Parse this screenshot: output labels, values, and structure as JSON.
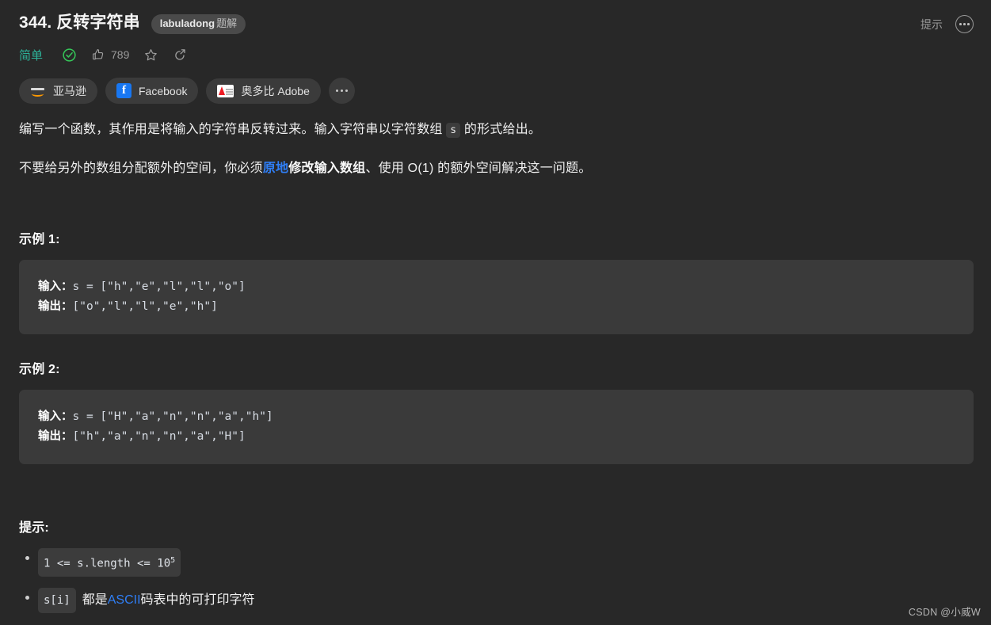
{
  "header": {
    "title": "344. 反转字符串",
    "solution_badge_main": "labuladong",
    "solution_badge_sub": "题解",
    "hint_label": "提示",
    "more_icon": "ellipsis-circle-icon"
  },
  "stats": {
    "difficulty": "简单",
    "difficulty_color": "#2db39a",
    "solved_icon": "check-circle-icon",
    "solved_color": "#35c759",
    "likes_icon": "thumbs-up-icon",
    "likes_count": "789",
    "favorite_icon": "star-icon",
    "share_icon": "share-icon"
  },
  "companies": [
    {
      "logo": "amazon-logo-icon",
      "label": "亚马逊"
    },
    {
      "logo": "facebook-logo-icon",
      "label": "Facebook"
    },
    {
      "logo": "adobe-logo-icon",
      "label": "奥多比 Adobe"
    }
  ],
  "companies_more_icon": "ellipsis-icon",
  "description": {
    "p1_part1": "编写一个函数，其作用是将输入的字符串反转过来。输入字符串以字符数组 ",
    "p1_code": "s",
    "p1_part2": " 的形式给出。",
    "p2_part1": "不要给另外的数组分配额外的空间，你必须",
    "p2_link": "原地",
    "p2_bold": "修改输入数组",
    "p2_part2": "、使用 O(1) 的额外空间解决这一问题。"
  },
  "examples": [
    {
      "heading": "示例 1:",
      "input_label": "输入：",
      "input_value": "s = [\"h\",\"e\",\"l\",\"l\",\"o\"]",
      "output_label": "输出：",
      "output_value": "[\"o\",\"l\",\"l\",\"e\",\"h\"]"
    },
    {
      "heading": "示例 2:",
      "input_label": "输入：",
      "input_value": "s = [\"H\",\"a\",\"n\",\"n\",\"a\",\"h\"]",
      "output_label": "输出：",
      "output_value": "[\"h\",\"a\",\"n\",\"n\",\"a\",\"H\"]"
    }
  ],
  "constraints": {
    "heading": "提示:",
    "item1_code_base": "1 <= s.length <= 10",
    "item1_code_sup": "5",
    "item2_code": "s[i]",
    "item2_text_before": "都是 ",
    "item2_link": "ASCII",
    "item2_text_after": " 码表中的可打印字符"
  },
  "watermark": "CSDN @小威W",
  "colors": {
    "page_bg": "#282828",
    "code_bg": "#3a3a3a",
    "chip_bg": "#3c3c3c",
    "link_blue": "#2f7ff7",
    "teal": "#2db39a",
    "green": "#35c759"
  }
}
